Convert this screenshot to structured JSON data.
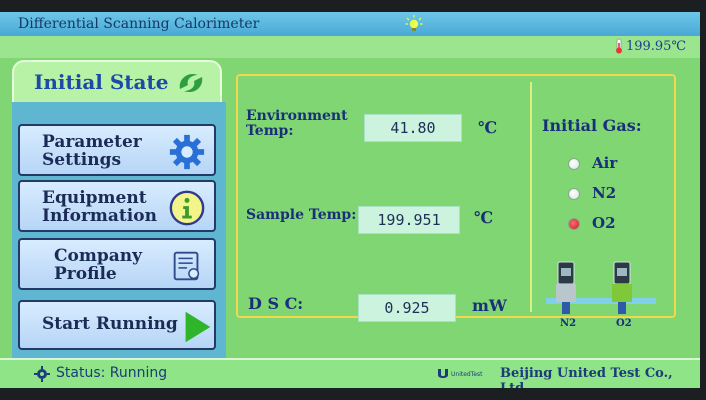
{
  "window": {
    "title": "Differential Scanning Calorimeter"
  },
  "topbar": {
    "temperature": "199.95℃"
  },
  "menu": {
    "state_title": "Initial State",
    "items": [
      {
        "line1": "Parameter",
        "line2": "Settings"
      },
      {
        "line1": "Equipment",
        "line2": "Information"
      },
      {
        "line1": "Company",
        "line2": "Profile"
      },
      {
        "line1": "Start Running"
      }
    ]
  },
  "readings": {
    "environment_label1": "Environment",
    "environment_label2": "Temp:",
    "environment_value": "41.80",
    "environment_unit": "℃",
    "sample_label": "Sample Temp:",
    "sample_value": "199.951",
    "sample_unit": "℃",
    "dsc_label": "D S C:",
    "dsc_value": "0.925",
    "dsc_unit": "mW"
  },
  "gas": {
    "title": "Initial Gas:",
    "options": [
      {
        "label": "Air",
        "selected": false
      },
      {
        "label": "N2",
        "selected": false
      },
      {
        "label": "O2",
        "selected": true
      }
    ],
    "valve_labels": [
      "N2",
      "O2"
    ]
  },
  "status": {
    "text": "Status: Running"
  },
  "company": {
    "brand_small": "UnitedTest",
    "name": "Beijing United Test Co., Ltd"
  },
  "colors": {
    "screen_bg": "#7fd672",
    "title_bar": "#4aa8d6",
    "text_blue": "#1a2f7a",
    "selected_radio": "#c81e1e"
  }
}
